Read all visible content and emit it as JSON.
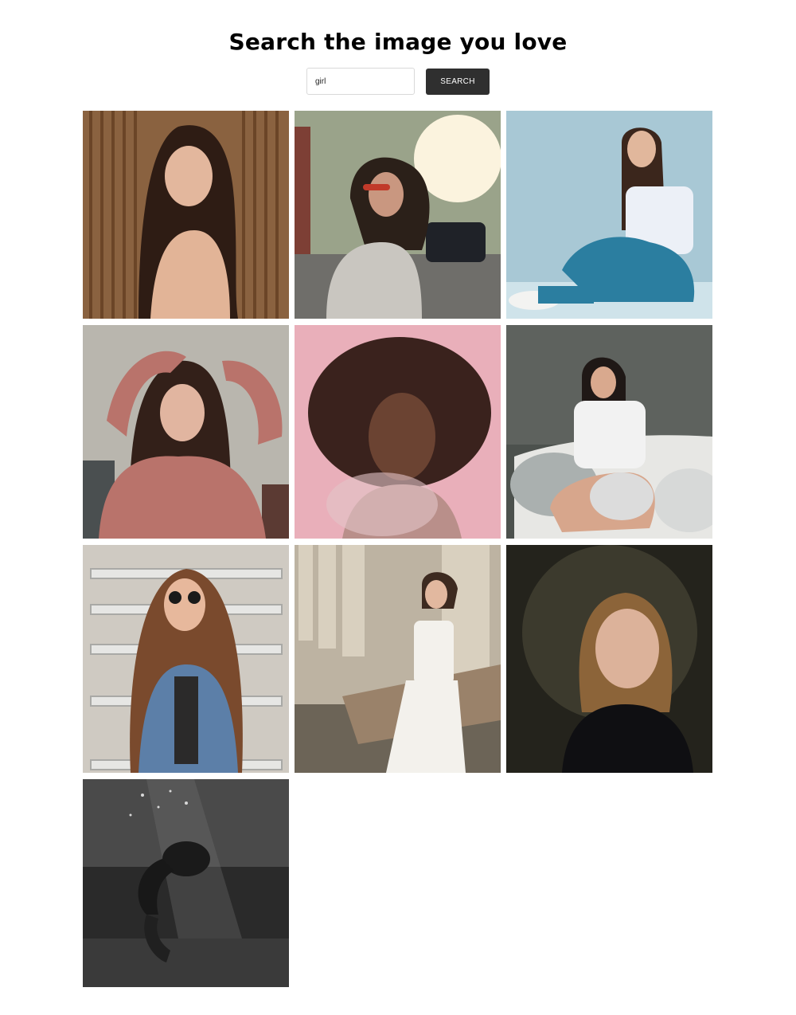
{
  "header": {
    "title": "Search the image you love"
  },
  "search": {
    "value": "girl",
    "button_label": "SEARCH"
  },
  "gallery": {
    "photos": [
      {
        "subject": "woman-long-hair-wooden-wall"
      },
      {
        "subject": "woman-sunglasses-street-sunset"
      },
      {
        "subject": "woman-white-top-jeans-sitting"
      },
      {
        "subject": "woman-pink-sweater-arms-raised"
      },
      {
        "subject": "woman-curly-hair-pink-background"
      },
      {
        "subject": "woman-white-hoodie-sofa"
      },
      {
        "subject": "woman-sunglasses-denim-stairs"
      },
      {
        "subject": "woman-white-overalls-columns"
      },
      {
        "subject": "girl-portrait-dark-background"
      },
      {
        "subject": "person-underwater-monochrome"
      }
    ]
  }
}
